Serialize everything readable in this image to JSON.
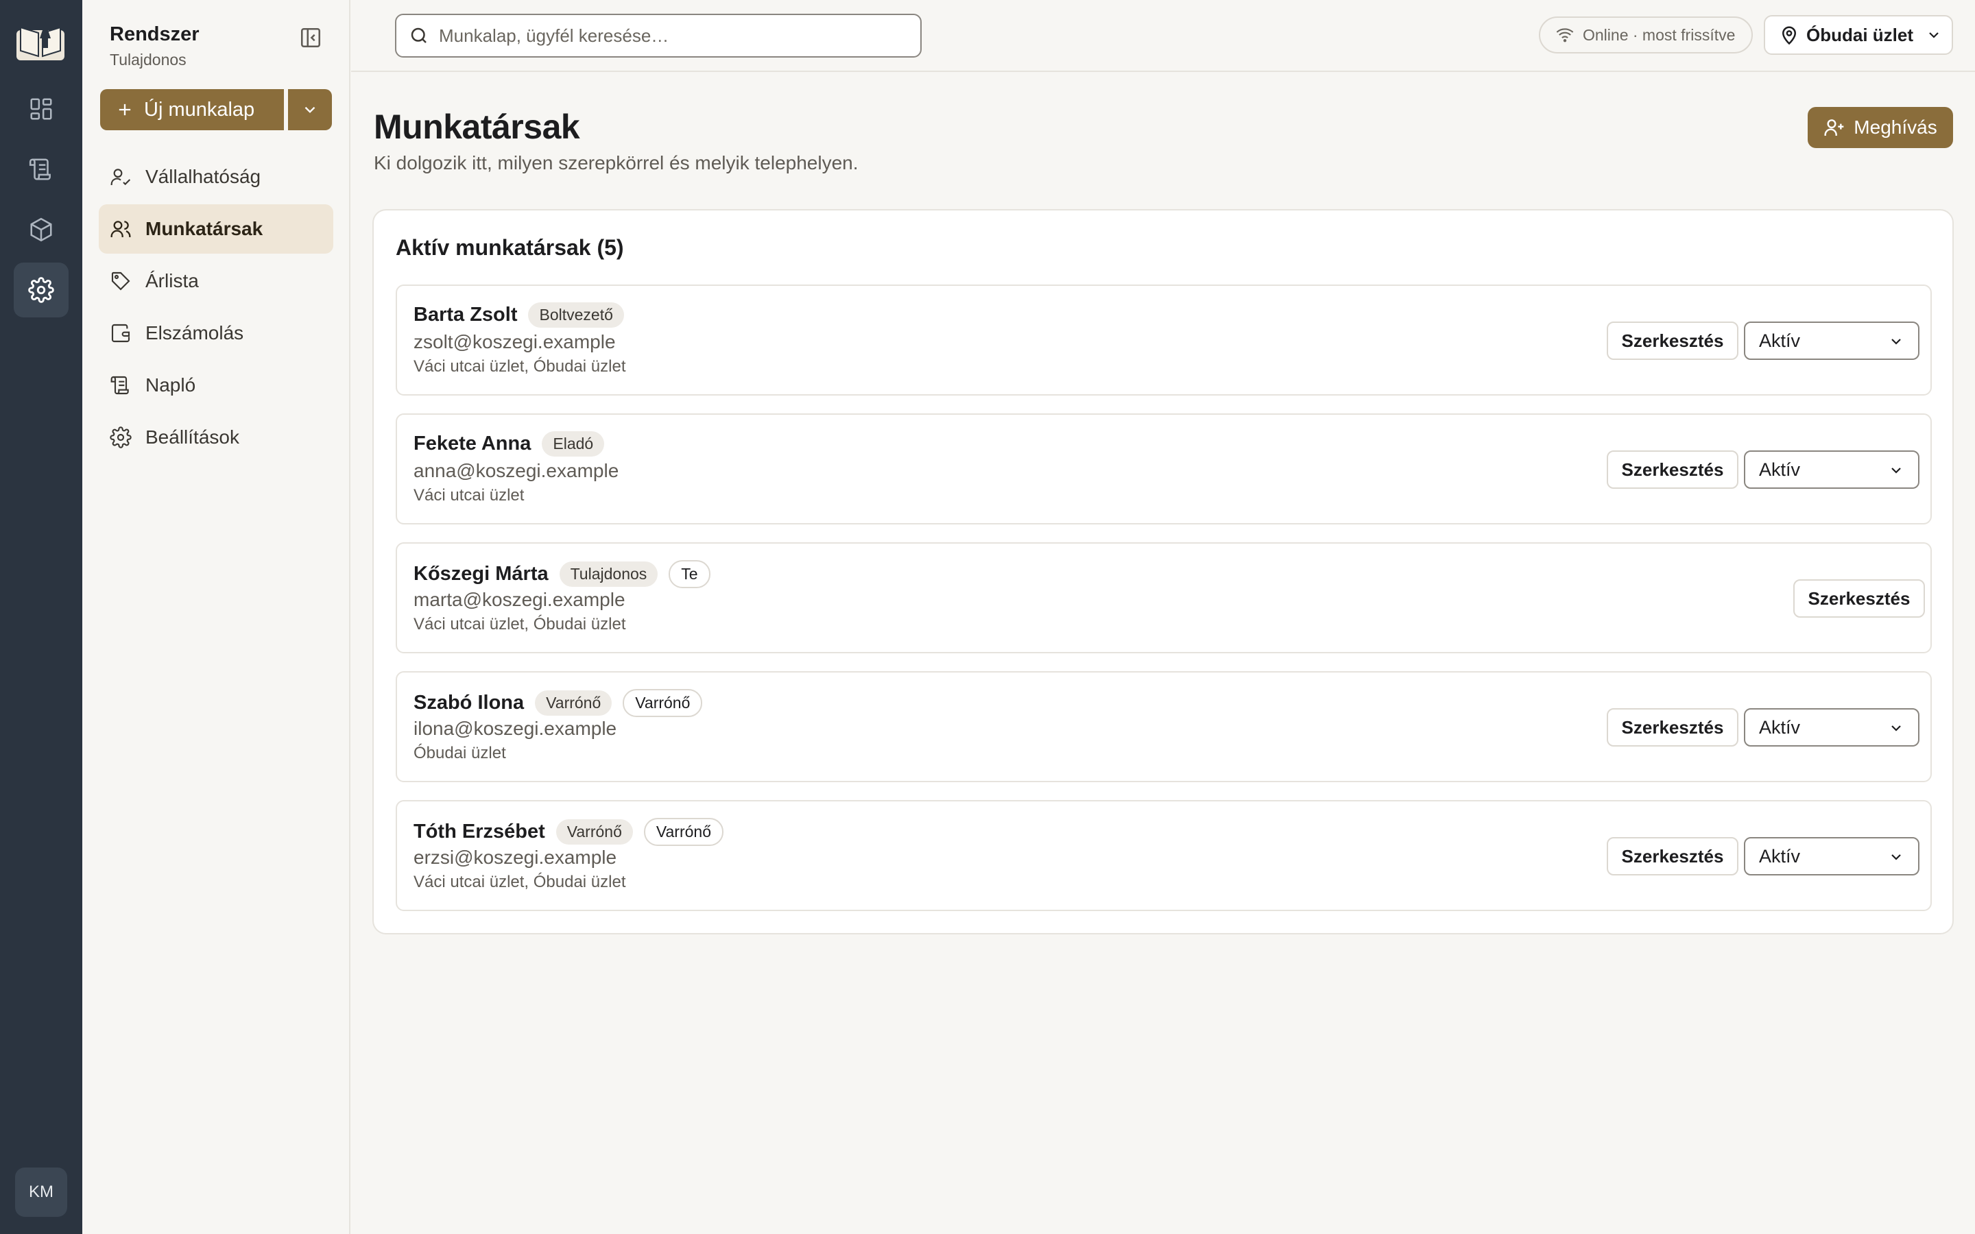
{
  "rail": {
    "avatar_initials": "KM"
  },
  "sidebar": {
    "title": "Rendszer",
    "subtitle": "Tulajdonos",
    "new_button_label": "Új munkalap",
    "items": [
      {
        "label": "Vállalhatóság",
        "icon": "user-check-icon"
      },
      {
        "label": "Munkatársak",
        "icon": "users-icon",
        "active": true
      },
      {
        "label": "Árlista",
        "icon": "tag-icon"
      },
      {
        "label": "Elszámolás",
        "icon": "wallet-icon"
      },
      {
        "label": "Napló",
        "icon": "scroll-icon"
      },
      {
        "label": "Beállítások",
        "icon": "gear-icon"
      }
    ]
  },
  "topbar": {
    "search_placeholder": "Munkalap, ügyfél keresése…",
    "status_text": "Online · most frissítve",
    "location_label": "Óbudai üzlet"
  },
  "page": {
    "title": "Munkatársak",
    "description": "Ki dolgozik itt, milyen szerepkörrel és melyik telephelyen.",
    "invite_label": "Meghívás"
  },
  "card": {
    "title": "Aktív munkatársak (5)",
    "edit_label": "Szerkesztés",
    "rows": [
      {
        "name": "Barta Zsolt",
        "badges": [
          {
            "text": "Boltvezető",
            "style": "filled"
          }
        ],
        "email": "zsolt@koszegi.example",
        "locations": "Váci utcai üzlet, Óbudai üzlet",
        "status": "Aktív"
      },
      {
        "name": "Fekete Anna",
        "badges": [
          {
            "text": "Eladó",
            "style": "filled"
          }
        ],
        "email": "anna@koszegi.example",
        "locations": "Váci utcai üzlet",
        "status": "Aktív"
      },
      {
        "name": "Kőszegi Márta",
        "badges": [
          {
            "text": "Tulajdonos",
            "style": "filled"
          },
          {
            "text": "Te",
            "style": "outline"
          }
        ],
        "email": "marta@koszegi.example",
        "locations": "Váci utcai üzlet, Óbudai üzlet",
        "status": null
      },
      {
        "name": "Szabó Ilona",
        "badges": [
          {
            "text": "Varrónő",
            "style": "filled"
          },
          {
            "text": "Varrónő",
            "style": "outline"
          }
        ],
        "email": "ilona@koszegi.example",
        "locations": "Óbudai üzlet",
        "status": "Aktív"
      },
      {
        "name": "Tóth Erzsébet",
        "badges": [
          {
            "text": "Varrónő",
            "style": "filled"
          },
          {
            "text": "Varrónő",
            "style": "outline"
          }
        ],
        "email": "erzsi@koszegi.example",
        "locations": "Váci utcai üzlet, Óbudai üzlet",
        "status": "Aktív"
      }
    ]
  },
  "colors": {
    "accent": "#8a6d3b",
    "rail": "#2b3440",
    "active_nav": "#efe6d7"
  }
}
